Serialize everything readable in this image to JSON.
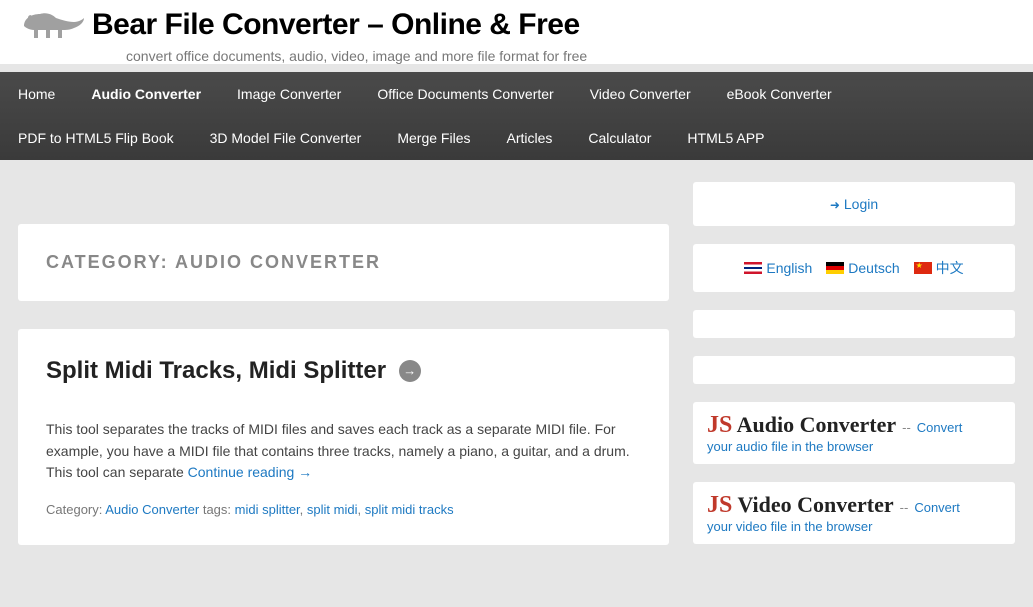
{
  "site": {
    "title": "Bear File Converter – Online & Free",
    "tagline": "convert office documents, audio, video, image and more file format for free"
  },
  "nav": {
    "items": [
      "Home",
      "Audio Converter",
      "Image Converter",
      "Office Documents Converter",
      "Video Converter",
      "eBook Converter",
      "PDF to HTML5 Flip Book",
      "3D Model File Converter",
      "Merge Files",
      "Articles",
      "Calculator",
      "HTML5 APP"
    ],
    "active_index": 1
  },
  "category": {
    "label": "CATEGORY: AUDIO CONVERTER"
  },
  "article": {
    "title": "Split Midi Tracks, Midi Splitter",
    "body": "This tool separates the tracks of MIDI files and saves each track as a separate MIDI file. For example, you have a MIDI file that contains three tracks, namely a piano, a guitar, and a drum. This tool can separate ",
    "continue": "Continue reading →",
    "meta": {
      "category_label": "Category: ",
      "category_value": "Audio Converter",
      "tags_label": " tags: ",
      "tags": [
        "midi splitter",
        "split midi",
        "split midi tracks"
      ]
    }
  },
  "sidebar": {
    "login": "Login",
    "languages": [
      {
        "label": "English",
        "flag": "en"
      },
      {
        "label": "Deutsch",
        "flag": "de"
      },
      {
        "label": "中文",
        "flag": "cn"
      }
    ],
    "converters": [
      {
        "js": "JS",
        "title": "Audio Converter",
        "dash": "--",
        "link": "Convert",
        "desc": "your audio file in the browser"
      },
      {
        "js": "JS",
        "title": "Video Converter",
        "dash": "--",
        "link": "Convert",
        "desc": "your video file in the browser"
      }
    ]
  }
}
